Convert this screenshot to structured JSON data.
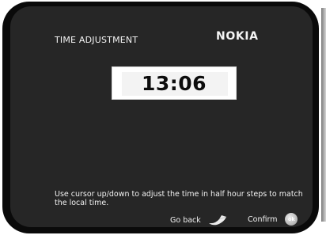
{
  "screen": {
    "title": "TIME ADJUSTMENT",
    "brand": "NOKIA",
    "time": "13:06",
    "instruction": "Use cursor up/down to adjust the time in half hour steps to match the local time."
  },
  "footer": {
    "go_back_label": "Go back",
    "go_back_icon": "back-arrow-icon",
    "confirm_label": "Confirm",
    "ok_icon_label": "ok"
  },
  "colors": {
    "screen_background": "#262626",
    "frame": "#0a0a0a",
    "text": "#f4f4f4",
    "time_box": "#ffffff"
  }
}
